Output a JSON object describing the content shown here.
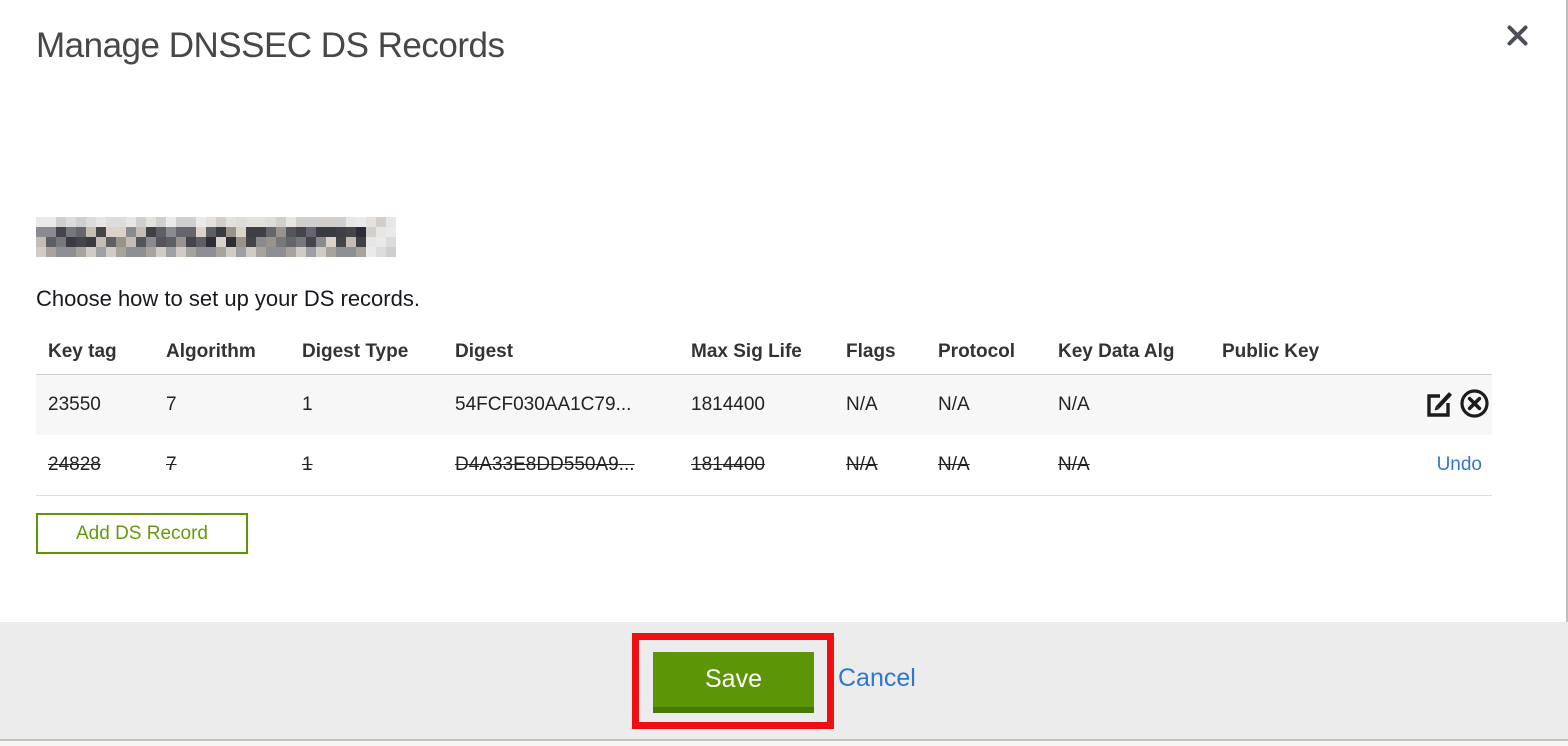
{
  "dialog": {
    "title": "Manage DNSSEC DS Records",
    "instruction": "Choose how to set up your DS records."
  },
  "table": {
    "columns": {
      "key_tag": "Key tag",
      "algorithm": "Algorithm",
      "digest_type": "Digest Type",
      "digest": "Digest",
      "max_sig_life": "Max Sig Life",
      "flags": "Flags",
      "protocol": "Protocol",
      "key_data_alg": "Key Data Alg",
      "public_key": "Public Key"
    },
    "rows": [
      {
        "key_tag": "23550",
        "algorithm": "7",
        "digest_type": "1",
        "digest": "54FCF030AA1C79...",
        "max_sig_life": "1814400",
        "flags": "N/A",
        "protocol": "N/A",
        "key_data_alg": "N/A",
        "public_key": "",
        "state": "active"
      },
      {
        "key_tag": "24828",
        "algorithm": "7",
        "digest_type": "1",
        "digest": "D4A33E8DD550A9...",
        "max_sig_life": "1814400",
        "flags": "N/A",
        "protocol": "N/A",
        "key_data_alg": "N/A",
        "public_key": "",
        "state": "marked-for-deletion",
        "action_label": "Undo"
      }
    ]
  },
  "buttons": {
    "add_ds_record": "Add DS Record",
    "save": "Save",
    "cancel": "Cancel"
  },
  "colors": {
    "save_green": "#5c9505",
    "outline_green": "#5e9502",
    "link_blue": "#2e77d0",
    "annotation_red": "#ee1010",
    "footer_bg": "#ececec",
    "row_alt_bg": "#f7f7f7"
  }
}
